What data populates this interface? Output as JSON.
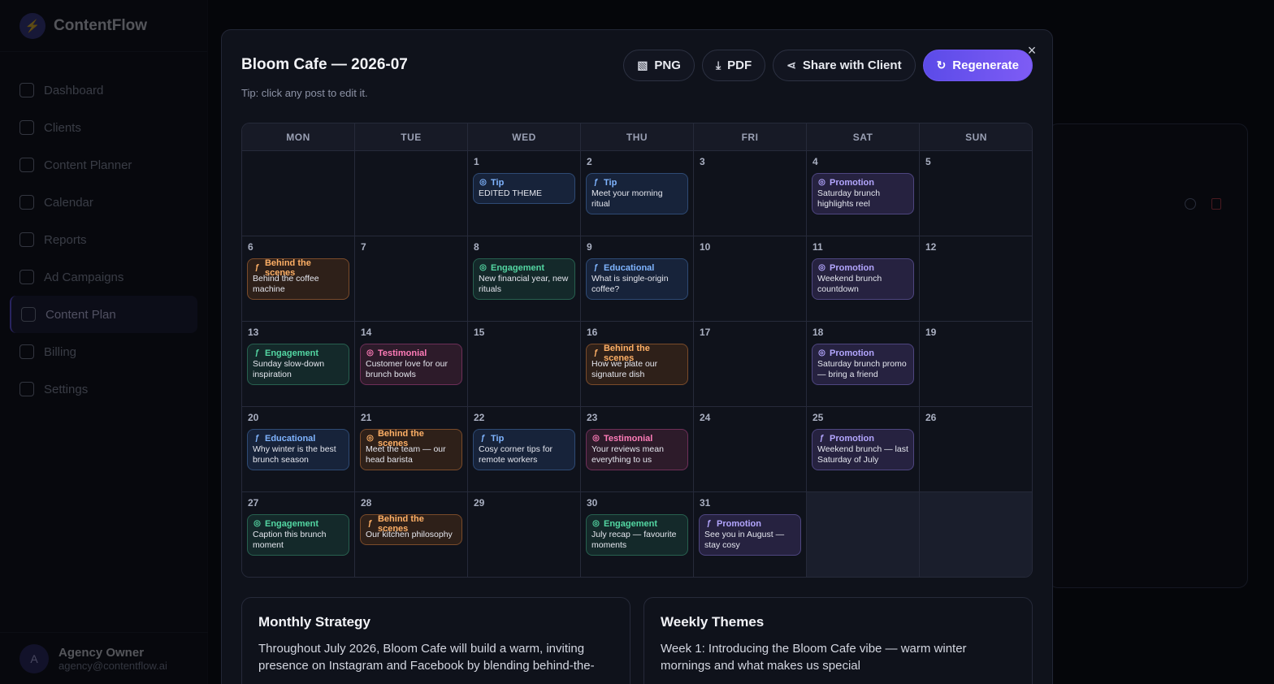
{
  "app": {
    "name": "ContentFlow"
  },
  "sidebar": {
    "items": [
      {
        "label": "Dashboard",
        "icon": "grid-icon"
      },
      {
        "label": "Clients",
        "icon": "users-icon"
      },
      {
        "label": "Content Planner",
        "icon": "edit-icon"
      },
      {
        "label": "Calendar",
        "icon": "calendar-icon"
      },
      {
        "label": "Reports",
        "icon": "report-icon"
      },
      {
        "label": "Ad Campaigns",
        "icon": "megaphone-icon"
      },
      {
        "label": "Content Plan",
        "icon": "calendar-icon",
        "active": true
      },
      {
        "label": "Billing",
        "icon": "card-icon"
      },
      {
        "label": "Settings",
        "icon": "gear-icon"
      }
    ]
  },
  "user": {
    "initial": "A",
    "name": "Agency Owner",
    "email": "agency@contentflow.ai"
  },
  "modal": {
    "title": "Bloom Cafe — 2026-07",
    "tip": "Tip: click any post to edit it.",
    "close": "×",
    "actions": {
      "png": "PNG",
      "pdf": "PDF",
      "share": "Share with Client",
      "regenerate": "Regenerate"
    }
  },
  "calendar": {
    "weekdays": [
      "MON",
      "TUE",
      "WED",
      "THU",
      "FRI",
      "SAT",
      "SUN"
    ],
    "leading_blanks": 2,
    "days": [
      {
        "n": "1",
        "post": {
          "type": "t-tip",
          "icon": "instagram",
          "cat": "Tip",
          "text": "EDITED THEME"
        }
      },
      {
        "n": "2",
        "post": {
          "type": "t-tip",
          "icon": "facebook",
          "cat": "Tip",
          "text": "Meet your morning ritual"
        }
      },
      {
        "n": "3"
      },
      {
        "n": "4",
        "post": {
          "type": "t-promo",
          "icon": "instagram",
          "cat": "Promotion",
          "text": "Saturday brunch highlights reel"
        }
      },
      {
        "n": "5"
      },
      {
        "n": "6",
        "post": {
          "type": "t-bts",
          "icon": "facebook",
          "cat": "Behind the scenes",
          "text": "Behind the coffee machine"
        }
      },
      {
        "n": "7"
      },
      {
        "n": "8",
        "post": {
          "type": "t-eng",
          "icon": "instagram",
          "cat": "Engagement",
          "text": "New financial year, new rituals"
        }
      },
      {
        "n": "9",
        "post": {
          "type": "t-edu",
          "icon": "facebook",
          "cat": "Educational",
          "text": "What is single-origin coffee?"
        }
      },
      {
        "n": "10"
      },
      {
        "n": "11",
        "post": {
          "type": "t-promo",
          "icon": "instagram",
          "cat": "Promotion",
          "text": "Weekend brunch countdown"
        }
      },
      {
        "n": "12"
      },
      {
        "n": "13",
        "post": {
          "type": "t-eng",
          "icon": "facebook",
          "cat": "Engagement",
          "text": "Sunday slow-down inspiration"
        }
      },
      {
        "n": "14",
        "post": {
          "type": "t-test",
          "icon": "instagram",
          "cat": "Testimonial",
          "text": "Customer love for our brunch bowls"
        }
      },
      {
        "n": "15"
      },
      {
        "n": "16",
        "post": {
          "type": "t-bts",
          "icon": "facebook",
          "cat": "Behind the scenes",
          "text": "How we plate our signature dish"
        }
      },
      {
        "n": "17"
      },
      {
        "n": "18",
        "post": {
          "type": "t-promo",
          "icon": "instagram",
          "cat": "Promotion",
          "text": "Saturday brunch promo — bring a friend"
        }
      },
      {
        "n": "19"
      },
      {
        "n": "20",
        "post": {
          "type": "t-edu",
          "icon": "facebook",
          "cat": "Educational",
          "text": "Why winter is the best brunch season"
        }
      },
      {
        "n": "21",
        "post": {
          "type": "t-bts",
          "icon": "instagram",
          "cat": "Behind the scenes",
          "text": "Meet the team — our head barista"
        }
      },
      {
        "n": "22",
        "post": {
          "type": "t-tip",
          "icon": "facebook",
          "cat": "Tip",
          "text": "Cosy corner tips for remote workers"
        }
      },
      {
        "n": "23",
        "post": {
          "type": "t-test",
          "icon": "instagram",
          "cat": "Testimonial",
          "text": "Your reviews mean everything to us"
        }
      },
      {
        "n": "24"
      },
      {
        "n": "25",
        "post": {
          "type": "t-promo",
          "icon": "facebook",
          "cat": "Promotion",
          "text": "Weekend brunch — last Saturday of July"
        }
      },
      {
        "n": "26"
      },
      {
        "n": "27",
        "post": {
          "type": "t-eng",
          "icon": "instagram",
          "cat": "Engagement",
          "text": "Caption this brunch moment"
        }
      },
      {
        "n": "28",
        "post": {
          "type": "t-bts",
          "icon": "facebook",
          "cat": "Behind the scenes",
          "text": "Our kitchen philosophy"
        }
      },
      {
        "n": "29"
      },
      {
        "n": "30",
        "post": {
          "type": "t-eng",
          "icon": "instagram",
          "cat": "Engagement",
          "text": "July recap — favourite moments"
        }
      },
      {
        "n": "31",
        "post": {
          "type": "t-promo",
          "icon": "facebook",
          "cat": "Promotion",
          "text": "See you in August — stay cosy"
        }
      }
    ],
    "trailing_blanks": 2
  },
  "strategy": {
    "title": "Monthly Strategy",
    "body": "Throughout July 2026, Bloom Cafe will build a warm, inviting presence on Instagram and Facebook by blending behind-the-"
  },
  "themes": {
    "title": "Weekly Themes",
    "week1": "Week 1: Introducing the Bloom Cafe vibe — warm winter mornings and what makes us special"
  },
  "colors": {
    "accent": "#6d5cff",
    "background": "#05060a",
    "modal": "#0f121b"
  }
}
